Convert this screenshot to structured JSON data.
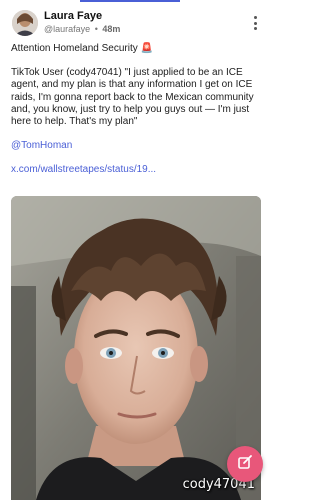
{
  "post": {
    "author_name": "Laura Faye",
    "author_handle": "@laurafaye",
    "separator": "•",
    "time_ago": "48m",
    "title": "Attention Homeland Security",
    "title_emoji": "🚨",
    "quote": "TikTok User (cody47041) \"I just applied to be an ICE agent, and my plan is that any information I get on ICE raids, I'm gonna report back to the Mexican community and, you know, just try to help you guys out — I'm just here to help. That's my plan\"",
    "mention": "@TomHoman",
    "link": "x.com/wallstreetapes/status/19..."
  },
  "media": {
    "watermark": "cody47041"
  },
  "colors": {
    "accent": "#4a5fd6",
    "fab": "#e8577a",
    "siren": "#e23b2e"
  },
  "icons": {
    "more": "more-vertical-icon",
    "fab": "compose-icon"
  }
}
